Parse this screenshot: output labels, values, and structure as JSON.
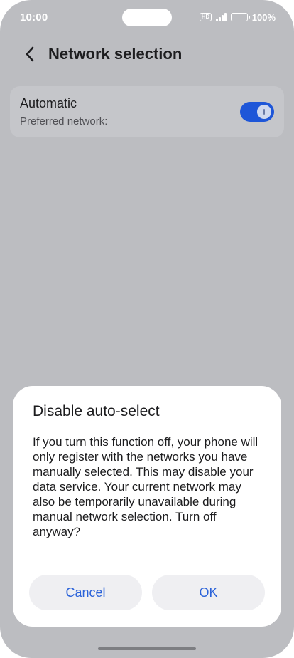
{
  "status_bar": {
    "time": "10:00",
    "hd_badge": "HD",
    "battery_percent": "100%"
  },
  "header": {
    "title": "Network selection"
  },
  "settings_row": {
    "title": "Automatic",
    "subtitle": "Preferred network:",
    "toggle_on": true
  },
  "dialog": {
    "title": "Disable auto-select",
    "message": "If you turn this function off, your phone will only register with the networks you have manually selected. This may disable your data service. Your current network may also be temporarily unavailable during manual network selection. Turn off anyway?",
    "cancel_label": "Cancel",
    "ok_label": "OK"
  },
  "colors": {
    "accent": "#2a62d9",
    "toggle_on": "#1e56d8",
    "dim_background": "#bcbdc1"
  }
}
